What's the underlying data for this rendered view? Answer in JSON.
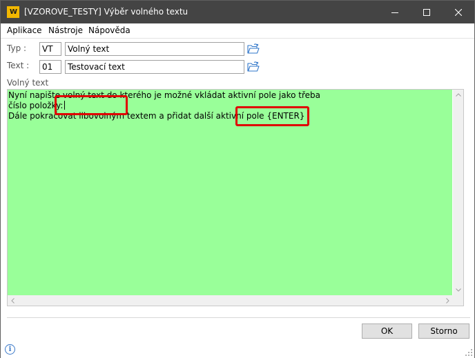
{
  "window": {
    "title": "[VZOROVE_TESTY] Výběr volného textu",
    "logo_text": "W"
  },
  "menu": {
    "items": [
      "Aplikace",
      "Nástroje",
      "Nápověda"
    ]
  },
  "form": {
    "typ": {
      "label": "Typ :",
      "code": "VT",
      "name": "Volný text"
    },
    "text": {
      "label": "Text :",
      "code": "01",
      "name": "Testovací text"
    },
    "volny_text_label": "Volný text"
  },
  "editor": {
    "background_color": "#99ff99",
    "lines": [
      "Nyní napište volný text do kterého je možné vkládat aktivní pole jako třeba",
      "číslo položky:",
      "Dále pokračovat libovolným textem a přidat další aktivní pole {ENTER}"
    ]
  },
  "annotation_color": "#e00000",
  "buttons": {
    "ok": "OK",
    "storno": "Storno"
  },
  "icons": {
    "folder": "folder-open-icon",
    "info": "info-icon"
  }
}
